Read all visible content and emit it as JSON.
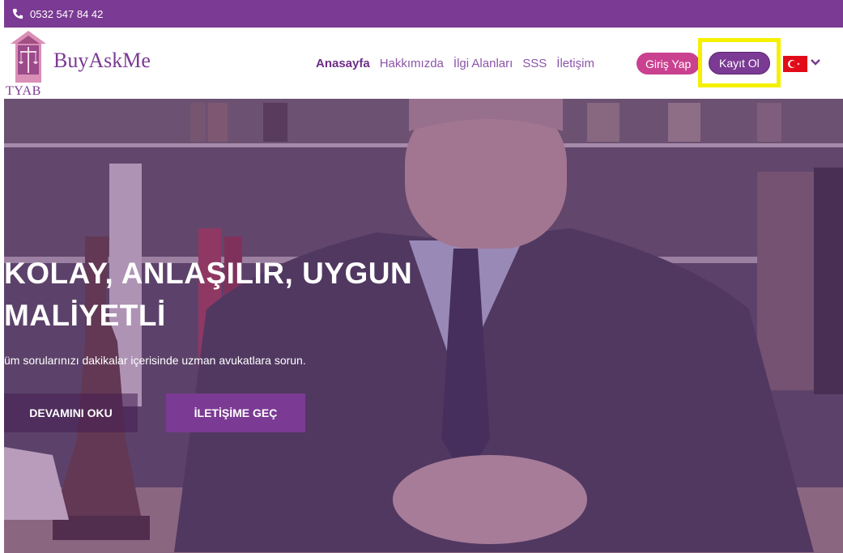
{
  "topbar": {
    "phone": "0532 547 84 42",
    "icon": "phone-icon"
  },
  "logo": {
    "brand": "BuyAskMe",
    "tagline": "TYAB"
  },
  "menu": {
    "items": [
      {
        "label": "Anasayfa",
        "active": true
      },
      {
        "label": "Hakkımızda"
      },
      {
        "label": "İlgi Alanları"
      },
      {
        "label": "SSS"
      },
      {
        "label": "İletişim"
      }
    ],
    "login_label": "Giriş Yap",
    "register_label": "Kayıt Ol",
    "language_icon": "turkey-flag-icon"
  },
  "hero": {
    "title_line1": "KOLAY, ANLAŞILIR, UYGUN",
    "title_line2": "MALİYETLİ",
    "subtitle": "üm sorularınızı dakikalar içerisinde uzman avukatlara sorun.",
    "read_more_label": "DEVAMINI OKU",
    "contact_label": "İLETİŞİME GEÇ"
  },
  "colors": {
    "brand": "#7b3a93",
    "login": "#c9418f",
    "highlight": "#f5f000"
  }
}
